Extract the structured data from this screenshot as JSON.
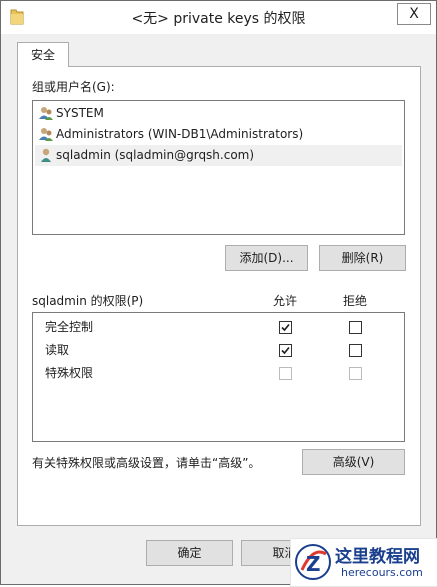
{
  "window": {
    "title": "<无> private keys 的权限",
    "close_label": "X"
  },
  "tabs": [
    {
      "label": "安全"
    }
  ],
  "security": {
    "group_label": "组或用户名(G):",
    "users": [
      {
        "name": "SYSTEM",
        "icon": "group-users-icon",
        "selected": false
      },
      {
        "name": "Administrators (WIN-DB1\\Administrators)",
        "icon": "group-users-icon",
        "selected": false
      },
      {
        "name": "sqladmin (sqladmin@grqsh.com)",
        "icon": "single-user-icon",
        "selected": true
      }
    ],
    "add_button": "添加(D)...",
    "remove_button": "删除(R)",
    "permissions_label": "sqladmin 的权限(P)",
    "allow_header": "允许",
    "deny_header": "拒绝",
    "permissions": [
      {
        "name": "完全控制",
        "allow": true,
        "deny": false,
        "enabled": true
      },
      {
        "name": "读取",
        "allow": true,
        "deny": false,
        "enabled": true
      },
      {
        "name": "特殊权限",
        "allow": false,
        "deny": false,
        "enabled": false
      }
    ],
    "advanced_hint": "有关特殊权限或高级设置，请单击“高级”。",
    "advanced_button": "高级(V)"
  },
  "footer": {
    "ok_button": "确定",
    "cancel_button": "取消"
  },
  "watermark": {
    "title": "这里教程网",
    "url": "herecours.com"
  },
  "colors": {
    "dialog_bg": "#f0f0f0",
    "selection_bg": "#f0f0f0",
    "button_bg": "#e1e1e1",
    "watermark_blue": "#1a3f8f"
  }
}
